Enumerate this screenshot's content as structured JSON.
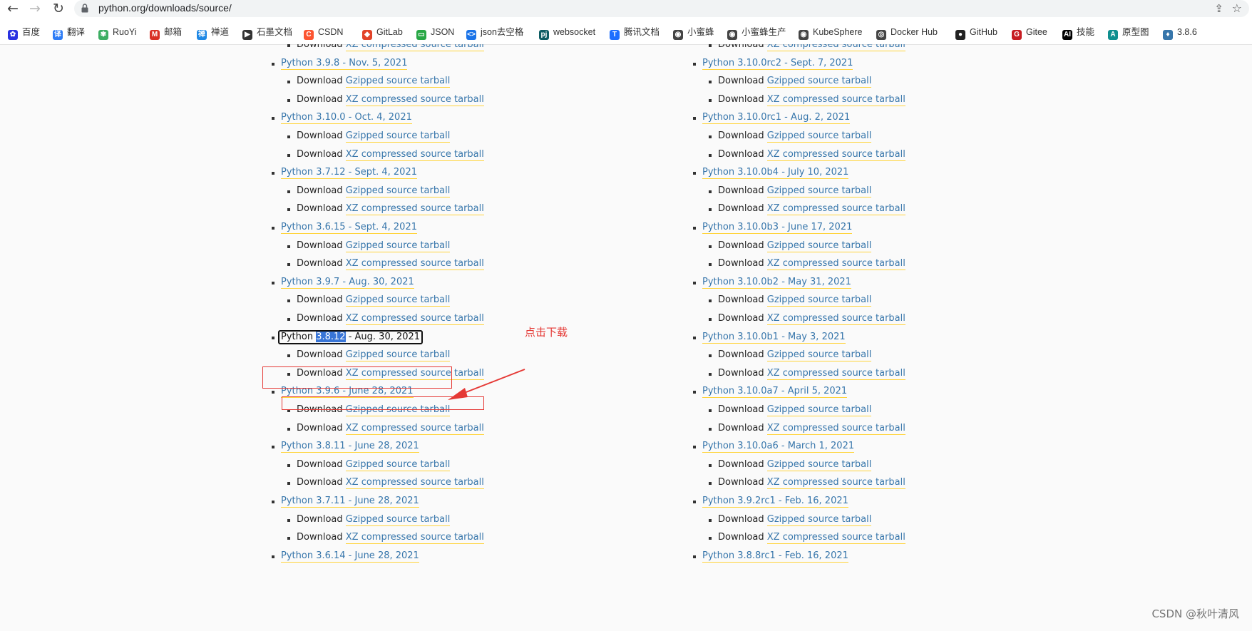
{
  "browser": {
    "url": "python.org/downloads/source/",
    "bookmarks": [
      {
        "label": "百度",
        "color": "#2932e1",
        "glyph": "✿"
      },
      {
        "label": "翻译",
        "color": "#2d7cf6",
        "glyph": "译"
      },
      {
        "label": "RuoYi",
        "color": "#3dae63",
        "glyph": "✾"
      },
      {
        "label": "邮箱",
        "color": "#d93025",
        "glyph": "M"
      },
      {
        "label": "禅道",
        "color": "#1e88e5",
        "glyph": "禅"
      },
      {
        "label": "石墨文档",
        "color": "#333333",
        "glyph": "▶"
      },
      {
        "label": "CSDN",
        "color": "#fc5531",
        "glyph": "C"
      },
      {
        "label": "GitLab",
        "color": "#e24329",
        "glyph": "◆"
      },
      {
        "label": "JSON",
        "color": "#28a745",
        "glyph": "▭"
      },
      {
        "label": "json去空格",
        "color": "#1a73e8",
        "glyph": "<>"
      },
      {
        "label": "websocket",
        "color": "#0d5c63",
        "glyph": "pj"
      },
      {
        "label": "腾讯文档",
        "color": "#1e6fff",
        "glyph": "T"
      },
      {
        "label": "小蜜蜂",
        "color": "#444444",
        "glyph": "◉"
      },
      {
        "label": "小蜜蜂生产",
        "color": "#444444",
        "glyph": "◉"
      },
      {
        "label": "KubeSphere",
        "color": "#444444",
        "glyph": "◉"
      },
      {
        "label": "Docker Hub",
        "color": "#444444",
        "glyph": "◎"
      },
      {
        "label": "GitHub",
        "color": "#222222",
        "glyph": "●"
      },
      {
        "label": "Gitee",
        "color": "#c71d23",
        "glyph": "G"
      },
      {
        "label": "技能",
        "color": "#000000",
        "glyph": "AI"
      },
      {
        "label": "原型图",
        "color": "#0f8f8f",
        "glyph": "A"
      },
      {
        "label": "3.8.6",
        "color": "#3776ab",
        "glyph": "♦"
      }
    ]
  },
  "labels": {
    "download": "Download",
    "gz": "Gzipped source tarball",
    "xz": "XZ compressed source tarball"
  },
  "columns": {
    "left": {
      "top_tail": "xz",
      "releases": [
        {
          "title": "Python 3.9.8 - Nov. 5, 2021",
          "files": [
            "gz",
            "xz"
          ]
        },
        {
          "title": "Python 3.10.0 - Oct. 4, 2021",
          "files": [
            "gz",
            "xz"
          ]
        },
        {
          "title": "Python 3.7.12 - Sept. 4, 2021",
          "files": [
            "gz",
            "xz"
          ]
        },
        {
          "title": "Python 3.6.15 - Sept. 4, 2021",
          "files": [
            "gz",
            "xz"
          ]
        },
        {
          "title": "Python 3.9.7 - Aug. 30, 2021",
          "files": [
            "gz",
            "xz"
          ]
        },
        {
          "title": "Python 3.8.12 - Aug. 30, 2021",
          "files": [
            "gz",
            "xz"
          ],
          "highlight": true
        },
        {
          "title": "Python 3.9.6 - June 28, 2021",
          "files": [
            "gz",
            "xz"
          ]
        },
        {
          "title": "Python 3.8.11 - June 28, 2021",
          "files": [
            "gz",
            "xz"
          ]
        },
        {
          "title": "Python 3.7.11 - June 28, 2021",
          "files": [
            "gz",
            "xz"
          ]
        },
        {
          "title": "Python 3.6.14 - June 28, 2021",
          "files": []
        }
      ]
    },
    "right": {
      "top_tail": "xz",
      "releases": [
        {
          "title": "Python 3.10.0rc2 - Sept. 7, 2021",
          "files": [
            "gz",
            "xz"
          ]
        },
        {
          "title": "Python 3.10.0rc1 - Aug. 2, 2021",
          "files": [
            "gz",
            "xz"
          ]
        },
        {
          "title": "Python 3.10.0b4 - July 10, 2021",
          "files": [
            "gz",
            "xz"
          ]
        },
        {
          "title": "Python 3.10.0b3 - June 17, 2021",
          "files": [
            "gz",
            "xz"
          ]
        },
        {
          "title": "Python 3.10.0b2 - May 31, 2021",
          "files": [
            "gz",
            "xz"
          ]
        },
        {
          "title": "Python 3.10.0b1 - May 3, 2021",
          "files": [
            "gz",
            "xz"
          ]
        },
        {
          "title": "Python 3.10.0a7 - April 5, 2021",
          "files": [
            "gz",
            "xz"
          ]
        },
        {
          "title": "Python 3.10.0a6 - March 1, 2021",
          "files": [
            "gz",
            "xz"
          ]
        },
        {
          "title": "Python 3.9.2rc1 - Feb. 16, 2021",
          "files": [
            "gz",
            "xz"
          ]
        },
        {
          "title": "Python 3.8.8rc1 - Feb. 16, 2021",
          "files": []
        }
      ]
    }
  },
  "highlight": {
    "prefix": "Python ",
    "selected": "3.8.12",
    "suffix": " - Aug. 30, 2021"
  },
  "annotation": {
    "label": "点击下载",
    "color": "#e53935"
  },
  "watermark": "CSDN @秋叶清风"
}
